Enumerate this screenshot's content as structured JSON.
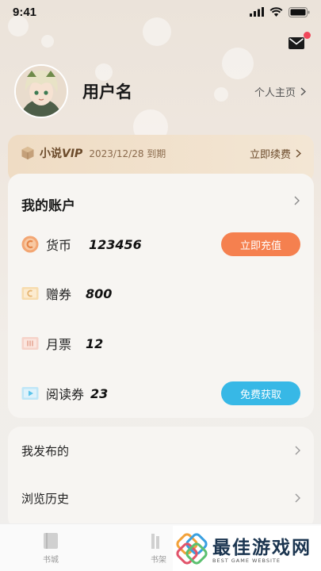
{
  "status_bar": {
    "time": "9:41"
  },
  "profile": {
    "username": "用户名",
    "homepage_link": "个人主页"
  },
  "vip": {
    "label_prefix": "小说",
    "label_vip": "VIP",
    "expiry": "2023/12/28 到期",
    "renew": "立即续费"
  },
  "account": {
    "title": "我的账户",
    "rows": [
      {
        "label": "货币",
        "value": "123456",
        "icon": "coin-icon",
        "button": "立即充值"
      },
      {
        "label": "赠券",
        "value": "800",
        "icon": "voucher-icon"
      },
      {
        "label": "月票",
        "value": "12",
        "icon": "monthly-ticket-icon"
      },
      {
        "label": "阅读券",
        "value": "23",
        "icon": "reading-ticket-icon",
        "button": "免费获取"
      }
    ]
  },
  "menu": {
    "items": [
      {
        "label": "我发布的"
      },
      {
        "label": "浏览历史"
      }
    ]
  },
  "tabbar": {
    "tabs": [
      {
        "label": "书城",
        "icon": "book-icon"
      },
      {
        "label": "书架",
        "icon": "bookshelf-icon"
      }
    ]
  },
  "watermark": {
    "title": "最佳游戏网",
    "subtitle": "BEST GAME WEBSITE"
  },
  "colors": {
    "recharge": "#f5804f",
    "free": "#37b8e6",
    "vip_bg": "#efdcc4",
    "mail_dot": "#f0475a"
  }
}
